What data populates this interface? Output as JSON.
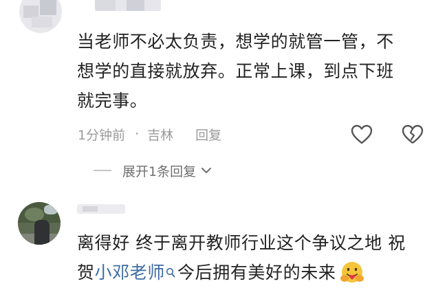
{
  "comments": [
    {
      "lines": [
        "当老师不必太负责，想学的就管一管，不",
        "想学的直接就放弃。正常上课，到点下班",
        "就完事。"
      ],
      "time": "1分钟前",
      "separator": "·",
      "location": "吉林",
      "reply_label": "回复",
      "expand_label": "展开1条回复"
    },
    {
      "line1": "离得好 终于离开教师行业这个争议之地 祝",
      "line2_prefix": "贺",
      "mention": "小邓老师",
      "line2_suffix": "今后拥有美好的未来"
    }
  ],
  "icons": {
    "like": "heart-outline-icon",
    "dislike": "broken-heart-outline-icon",
    "expand": "chevron-down-icon",
    "mention": "search-icon",
    "emoji": "hugging-face-emoji"
  },
  "colors": {
    "text": "#222222",
    "meta": "#9a9a9a",
    "mention": "#3d6ba5"
  }
}
